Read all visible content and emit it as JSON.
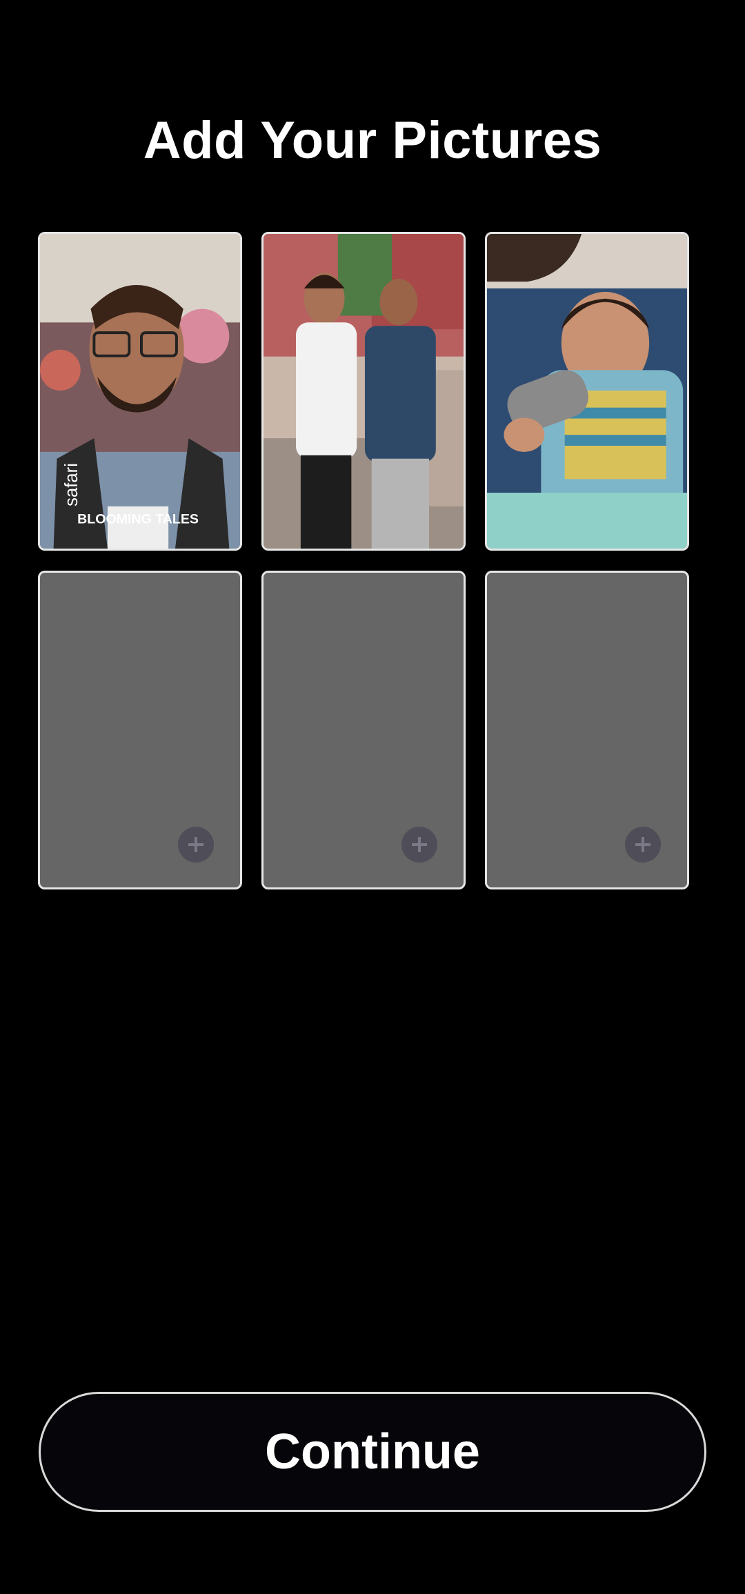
{
  "title": "Add Your Pictures",
  "photos": [
    {
      "description_icon": "selfie-photo",
      "overlay_text": "safari",
      "shirt_text": "BLOOMING TALES"
    },
    {
      "description_icon": "two-men-photo"
    },
    {
      "description_icon": "baby-drinking-photo"
    }
  ],
  "empty_slots": [
    {
      "icon": "plus-icon"
    },
    {
      "icon": "plus-icon"
    },
    {
      "icon": "plus-icon"
    }
  ],
  "continue_label": "Continue",
  "colors": {
    "background": "#000000",
    "tile_empty": "#666666",
    "add_button": "#4f4d57",
    "tile_border": "#e6e6e6"
  }
}
